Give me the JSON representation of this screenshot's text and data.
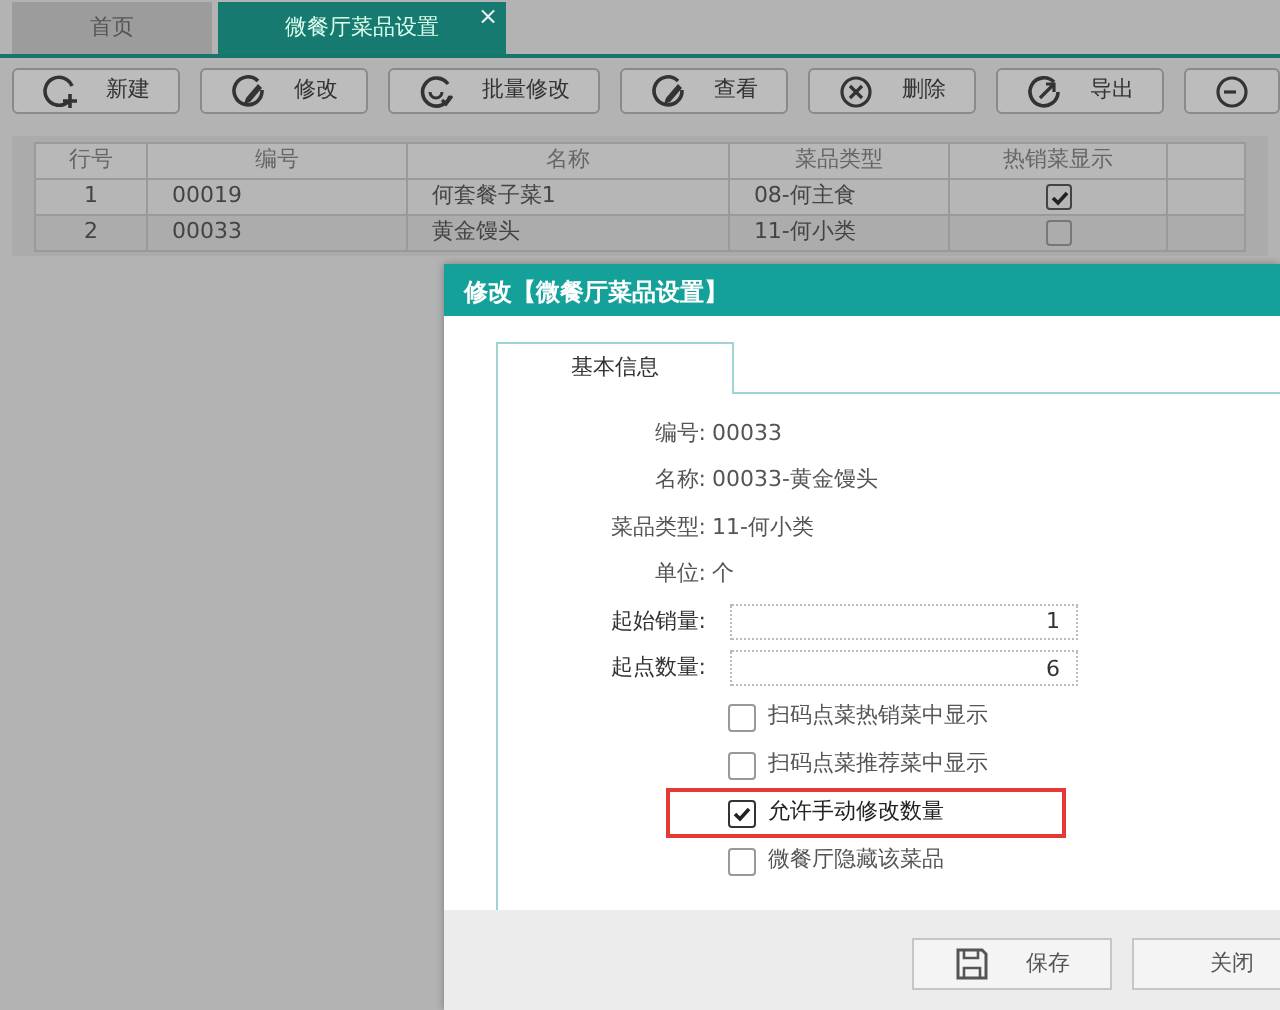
{
  "tabs": [
    {
      "label": "首页",
      "selected": false
    },
    {
      "label": "微餐厅菜品设置",
      "selected": true,
      "close": "×"
    }
  ],
  "toolbar": [
    {
      "kind": "add",
      "label": "新建"
    },
    {
      "kind": "edit",
      "label": "修改"
    },
    {
      "kind": "batch",
      "label": "批量修改"
    },
    {
      "kind": "edit",
      "label": "查看"
    },
    {
      "kind": "delete",
      "label": "删除"
    },
    {
      "kind": "export",
      "label": "导出"
    },
    {
      "kind": "minus"
    }
  ],
  "table": {
    "columns": [
      "行号",
      "编号",
      "名称",
      "菜品类型",
      "热销菜显示"
    ],
    "rows": [
      {
        "row_no": "1",
        "code": "00019",
        "name": "何套餐子菜1",
        "type": "08-何主食",
        "hot_display": true
      },
      {
        "row_no": "2",
        "code": "00033",
        "name": "黄金馒头",
        "type": "11-何小类",
        "hot_display": false
      }
    ]
  },
  "dialog": {
    "title": "修改【微餐厅菜品设置】",
    "tab": "基本信息",
    "info": [
      {
        "label": "编号:",
        "value": "00033"
      },
      {
        "label": "名称:",
        "value": "00033-黄金馒头"
      },
      {
        "label": "菜品类型:",
        "value": "11-何小类"
      },
      {
        "label": "单位:",
        "value": "个"
      }
    ],
    "inputs": [
      {
        "label": "起始销量:",
        "value": "1"
      },
      {
        "label": "起点数量:",
        "value": "6"
      }
    ],
    "checkboxes": [
      {
        "label": "扫码点菜热销菜中显示",
        "checked": false,
        "highlighted": false
      },
      {
        "label": "扫码点菜推荐菜中显示",
        "checked": false,
        "highlighted": false
      },
      {
        "label": "允许手动修改数量",
        "checked": true,
        "highlighted": true
      },
      {
        "label": "微餐厅隐藏该菜品",
        "checked": false,
        "highlighted": false
      }
    ],
    "buttons": [
      {
        "kind": "save",
        "label": "保存"
      },
      {
        "kind": "close",
        "label": "关闭"
      }
    ]
  }
}
